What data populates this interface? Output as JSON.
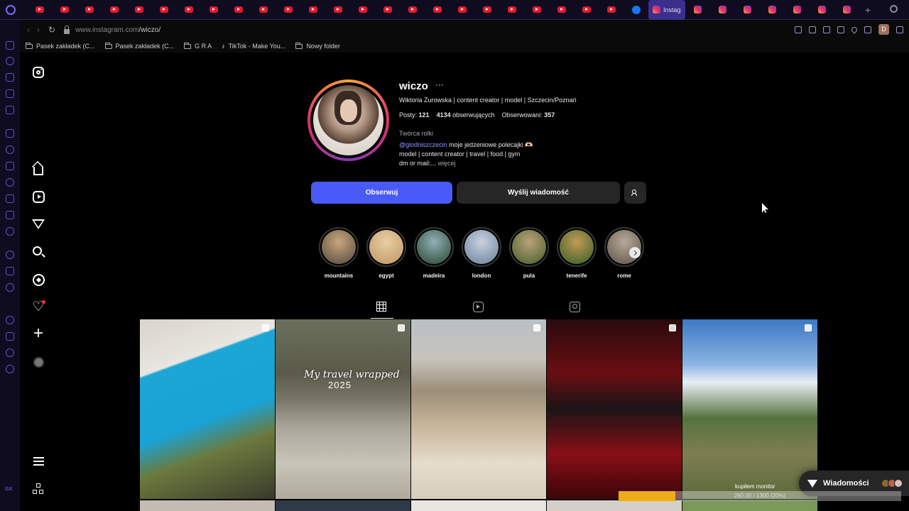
{
  "browser": {
    "active_tab_label": "Instag",
    "url_prefix": "www.instagram.com",
    "url_path": "/wiczo/",
    "bookmarks": [
      {
        "label": "Pasek zakładek (C...",
        "icon": "folder-icon"
      },
      {
        "label": "Pasek zakładek (C...",
        "icon": "folder-icon"
      },
      {
        "label": "G R A",
        "icon": "folder-icon"
      },
      {
        "label": "TikTok - Make You...",
        "icon": "tiktok-icon"
      },
      {
        "label": "Nowy folder",
        "icon": "folder-icon"
      }
    ],
    "profile_initial": "D",
    "accent_color": "#5e53d8"
  },
  "sidebar": {
    "gx_label": "GX"
  },
  "profile": {
    "username": "wiczo",
    "more_dots": "···",
    "full_name": "Wiktoria Żurowska | content creator | model | Szczecin/Poznań",
    "stats": {
      "posts_label": "Posty:",
      "posts_value": "121",
      "followers_value": "4134",
      "followers_label": "obserwujących",
      "following_label": "Obserwowani:",
      "following_value": "357"
    },
    "category": "Twórca rolki",
    "bio_mention": "@glodniszczecin",
    "bio_line1_rest": " moje jedzeniowe polecajki 🫶🏻",
    "bio_line2": "model | content creator | travel | food | gym",
    "bio_line3": "dm or mail:...",
    "bio_more": " więcej",
    "follow_button": "Obserwuj",
    "message_button": "Wyślij wiadomość",
    "follow_color": "#4a5af8"
  },
  "highlights": [
    {
      "label": "mountains",
      "colors": [
        "#6b5a4a",
        "#c9a77e"
      ]
    },
    {
      "label": "egypt",
      "colors": [
        "#c8a070",
        "#e7cfa6"
      ]
    },
    {
      "label": "madeira",
      "colors": [
        "#3e5a4a",
        "#8fb0b6"
      ]
    },
    {
      "label": "london",
      "colors": [
        "#7d8fa8",
        "#c8d3e0"
      ]
    },
    {
      "label": "pula",
      "colors": [
        "#5d6a3a",
        "#b9a27a"
      ]
    },
    {
      "label": "tenerife",
      "colors": [
        "#4e6a2e",
        "#c29a56"
      ]
    },
    {
      "label": "rome",
      "colors": [
        "#6e6358",
        "#b6a998"
      ]
    }
  ],
  "posts": [
    {
      "caption": "",
      "caption_sub": "",
      "bg": "linear-gradient(160deg, #d9d4cc 0%, #e8e6e0 25%, #1ca6d6 26%, #19a3d6 55%, #6b7a3e 70%, #3a3a2a 100%)"
    },
    {
      "caption": "My travel wrapped",
      "caption_sub": "2025",
      "bg": "linear-gradient(180deg, #6a6f5c 0%, #5b5a4a 30%, #7a7668 45%, #a9a59a 60%, #c9c4b8 80%, #b0aa9e 100%)"
    },
    {
      "caption": "",
      "caption_sub": "",
      "bg": "linear-gradient(180deg, #b9bfc6 0%, #c7c4bd 22%, #9c8e78 40%, #c9b79b 60%, #e6dccb 80%, #d7cdbb 100%)"
    },
    {
      "caption": "",
      "caption_sub": "",
      "bg": "linear-gradient(180deg, #2a0a0c 0%, #6a0e12 30%, #1b1416 50%, #8a0f17 75%, #3a0508 100%)"
    },
    {
      "caption": "",
      "caption_sub": "",
      "bg": "linear-gradient(180deg, #3c78c4 0%, #8ab4e2 25%, #e8eef5 35%, #56723e 55%, #7f7d52 75%, #5a6a3a 100%)"
    }
  ],
  "row2_colors": [
    "#c4bcb2",
    "#2f3a48",
    "#e9e6e1",
    "#d4cfc7",
    "#7a9a5a"
  ],
  "overlay": {
    "messages_label": "Wiadomości",
    "caption": "kupiłem monitor",
    "progress_text": "260.00 / 1300 (20%)",
    "progress_fraction": 0.2,
    "progress_color": "#f0ac16"
  }
}
